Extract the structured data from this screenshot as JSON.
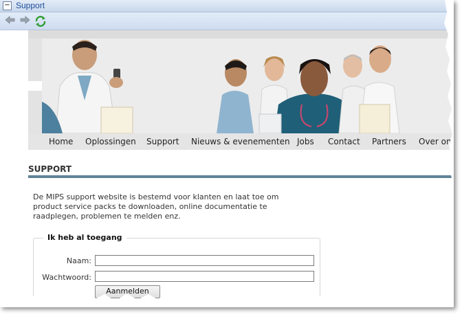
{
  "window": {
    "title": "Support",
    "collapse_glyph": "−"
  },
  "toolbar": {
    "back_icon": "back-arrow-icon",
    "forward_icon": "forward-arrow-icon",
    "refresh_icon": "refresh-icon"
  },
  "nav": {
    "items": [
      "Home",
      "Oplossingen",
      "Support",
      "Nieuws & evenementen",
      "Jobs",
      "Contact",
      "Partners",
      "Over ons"
    ]
  },
  "section": {
    "title": "SUPPORT",
    "intro": "De MIPS support website is bestemd voor klanten en laat toe om product service packs te downloaden, online documentatie te raadplegen, problemen te melden enz."
  },
  "login": {
    "legend": "Ik heb al toegang",
    "name_label": "Naam:",
    "name_value": "",
    "password_label": "Wachtwoord:",
    "password_value": "",
    "submit_label": "Aanmelden"
  },
  "colors": {
    "accent_rule": "#5f8496",
    "title_blue": "#1f4e9a",
    "toolbar_bg": "#d6e3f4"
  }
}
